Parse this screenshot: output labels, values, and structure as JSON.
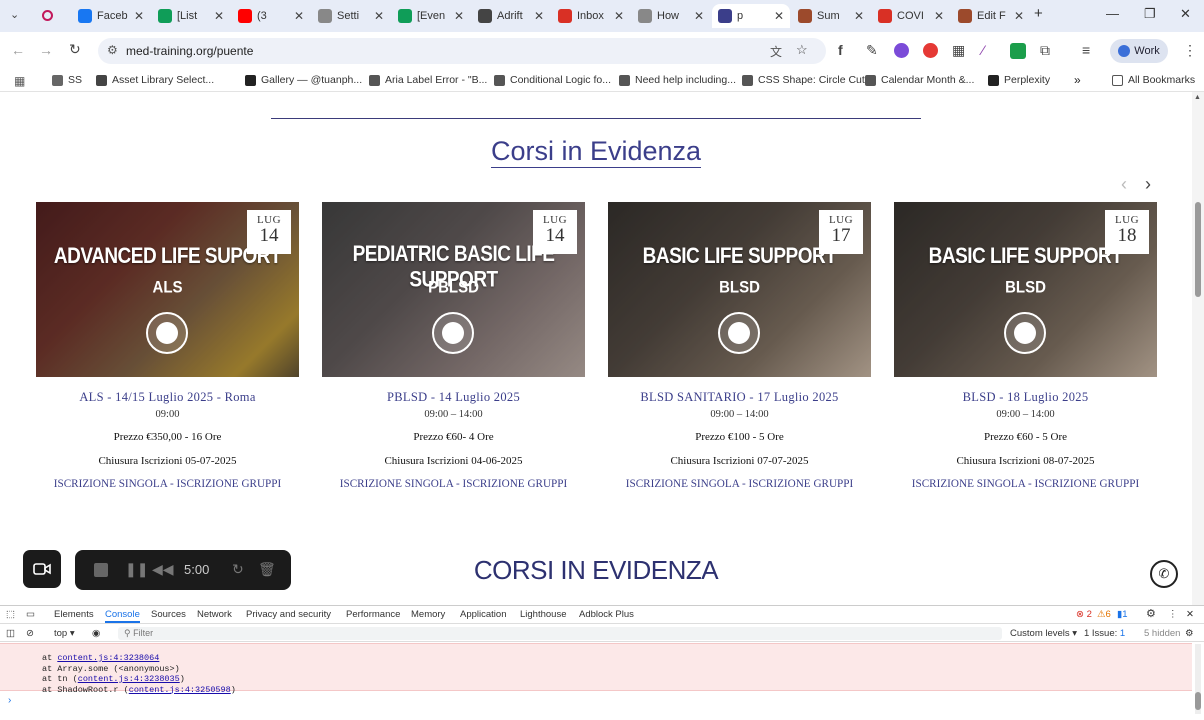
{
  "browser": {
    "tabs": [
      {
        "title": "Faceb",
        "color": "#1877f2"
      },
      {
        "title": "[List",
        "color": "#0f9d58"
      },
      {
        "title": "(3",
        "color": "#ff0000"
      },
      {
        "title": "Setti",
        "color": "#888888"
      },
      {
        "title": "[Even",
        "color": "#0f9d58"
      },
      {
        "title": "Adrift",
        "color": "#444444"
      },
      {
        "title": "Inbox",
        "color": "#d93025"
      },
      {
        "title": "How",
        "color": "#888888"
      },
      {
        "title": "p",
        "color": "#3b3e8a"
      },
      {
        "title": "Sum",
        "color": "#9c4a2c"
      },
      {
        "title": "COVI",
        "color": "#d93025"
      },
      {
        "title": "Edit F",
        "color": "#9c4a2c"
      }
    ],
    "url": "med-training.org/puente",
    "profile_label": "Work",
    "bookmarks": [
      "SS",
      "Asset Library Select...",
      "Gallery — @tuanph...",
      "Aria Label Error - \"B...",
      "Conditional Logic fo...",
      "Need help including...",
      "CSS Shape: Circle Cut",
      "Calendar Month &...",
      "Perplexity"
    ],
    "all_bookmarks_label": "All Bookmarks"
  },
  "page": {
    "heading": "Corsi in Evidenza",
    "heading2": "CORSI IN EVIDENZA",
    "courses": [
      {
        "img_title": "ADVANCED LIFE SUPORT",
        "img_sub": "ALS",
        "month": "LUG",
        "day": "14",
        "title": "ALS - 14/15 Luglio 2025 - Roma",
        "time": "09:00",
        "price": "Prezzo €350,00 - 16 Ore",
        "closing": "Chiusura Iscrizioni 05-07-2025",
        "links": "ISCRIZIONE SINGOLA - ISCRIZIONE GRUPPI"
      },
      {
        "img_title": "PEDIATRIC BASIC LIFE SUPPORT",
        "img_sub": "PBLSD",
        "month": "LUG",
        "day": "14",
        "title": "PBLSD - 14 Luglio 2025",
        "time": "09:00 – 14:00",
        "price": "Prezzo €60- 4 Ore",
        "closing": "Chiusura Iscrizioni 04-06-2025",
        "links": "ISCRIZIONE SINGOLA - ISCRIZIONE GRUPPI"
      },
      {
        "img_title": "BASIC LIFE SUPPORT",
        "img_sub": "BLSD",
        "month": "LUG",
        "day": "17",
        "title": "BLSD SANITARIO - 17 Luglio 2025",
        "time": "09:00 – 14:00",
        "price": "Prezzo €100 - 5 Ore",
        "closing": "Chiusura Iscrizioni 07-07-2025",
        "links": "ISCRIZIONE SINGOLA - ISCRIZIONE GRUPPI"
      },
      {
        "img_title": "BASIC LIFE SUPPORT",
        "img_sub": "BLSD",
        "month": "LUG",
        "day": "18",
        "title": "BLSD - 18 Luglio 2025",
        "time": "09:00 – 14:00",
        "price": "Prezzo €60 - 5 Ore",
        "closing": "Chiusura Iscrizioni 08-07-2025",
        "links": "ISCRIZIONE SINGOLA - ISCRIZIONE GRUPPI"
      }
    ]
  },
  "recorder": {
    "time": "5:00"
  },
  "devtools": {
    "tabs": [
      "Elements",
      "Console",
      "Sources",
      "Network",
      "Privacy and security",
      "Performance",
      "Memory",
      "Application",
      "Lighthouse",
      "Adblock Plus"
    ],
    "context": "top",
    "filter_placeholder": "Filter",
    "levels": "Custom levels",
    "issues": "1 Issue:",
    "issue_count": "1",
    "hidden": "5 hidden",
    "errors": "2",
    "warnings": "6",
    "info": "1",
    "stack": [
      {
        "prefix": "at ",
        "link": "content.js:4:3238064",
        "suffix": ""
      },
      {
        "prefix": "at Array.some (<anonymous>)",
        "link": "",
        "suffix": ""
      },
      {
        "prefix": "at tn (",
        "link": "content.js:4:3238035",
        "suffix": ")"
      },
      {
        "prefix": "at ShadowRoot.r (",
        "link": "content.js:4:3250598",
        "suffix": ")"
      }
    ]
  },
  "colors": {
    "accent": "#3b3e8a",
    "whatsapp": "#222222"
  }
}
